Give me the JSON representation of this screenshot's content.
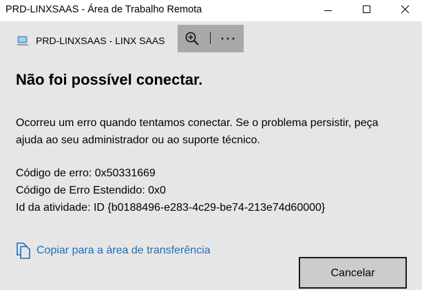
{
  "window": {
    "title": "PRD-LINXSAAS - Área de Trabalho Remota",
    "controls": {
      "minimize": "minimize-icon",
      "maximize": "maximize-icon",
      "close": "close-icon"
    }
  },
  "connection": {
    "icon": "computer-icon",
    "name": "PRD-LINXSAAS - LINX SAAS"
  },
  "toolbar": {
    "zoom_icon": "zoom-in-icon",
    "more_icon": "more-icon",
    "background": "#a9a9a9"
  },
  "error": {
    "heading": "Não foi possível conectar.",
    "message": "Ocorreu um erro quando tentamos conectar. Se o problema persistir, peça ajuda ao seu administrador ou ao suporte técnico.",
    "details": [
      "Código de erro: 0x50331669",
      "Código de Erro Estendido: 0x0",
      "Id da atividade: ID {b0188496-e283-4c29-be74-213e74d60000}"
    ]
  },
  "copy_link": {
    "icon": "copy-icon",
    "label": "Copiar para a área de transferência",
    "color": "#1a6fba"
  },
  "buttons": {
    "cancel": "Cancelar"
  },
  "colors": {
    "background": "#e6e6e6",
    "titlebar": "#ffffff"
  }
}
